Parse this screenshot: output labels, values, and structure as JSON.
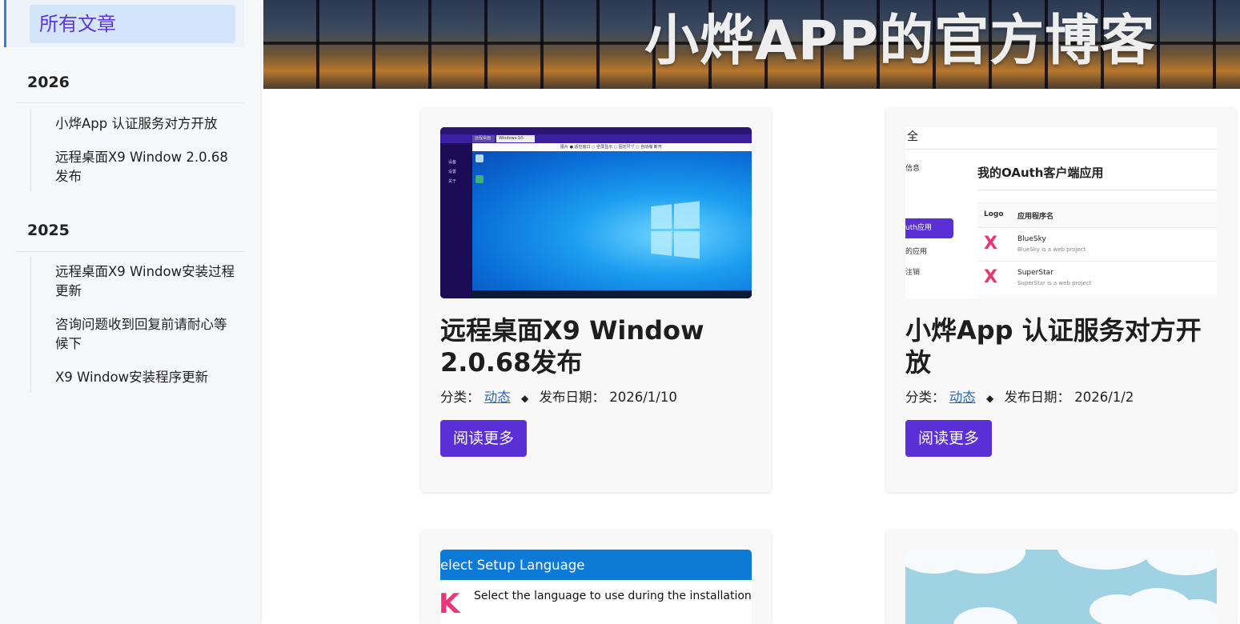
{
  "sidebar": {
    "all_posts": "所有文章",
    "groups": [
      {
        "year": "2026",
        "items": [
          "小烨App 认证服务对方开放",
          "远程桌面X9 Window 2.0.68发布"
        ]
      },
      {
        "year": "2025",
        "items": [
          "远程桌面X9 Window安装过程更新",
          "咨询问题收到回复前请耐心等候下",
          "X9 Window安装程序更新"
        ]
      }
    ]
  },
  "header": {
    "title": "小烨APP的官方博客"
  },
  "posts": [
    {
      "title": "远程桌面X9 Window 2.0.68发布",
      "category_label": "分类：",
      "category": "动态",
      "date_label": "发布日期：",
      "date": "2026/1/10",
      "read_more": "阅读更多",
      "thumb": {
        "tab1": "远程桌面",
        "tab2": "Windows 10-172.16.0.3",
        "toolbar": "图片 ● 适应窗口 ○ 全屏显示 ○ 固定尺寸 ○ 自动缩 断开",
        "side_items": [
          "设备",
          "设置",
          "关于"
        ]
      }
    },
    {
      "title": "小烨App 认证服务对方开放",
      "category_label": "分类：",
      "category": "动态",
      "date_label": "发布日期：",
      "date": "2026/1/2",
      "read_more": "阅读更多",
      "thumb": {
        "head": "全",
        "side_items": [
          "信息",
          "uth应用",
          "的应用",
          "注销"
        ],
        "title": "我的OAuth客户端应用",
        "col_logo": "Logo",
        "col_name": "应用程序名",
        "rows": [
          {
            "name": "BlueSky",
            "desc": "BlueSky is a web project"
          },
          {
            "name": "SuperStar",
            "desc": "SuperStar is a web project"
          }
        ]
      }
    },
    {
      "thumb": {
        "head": "elect Setup Language",
        "body": "Select the language to use during the installation."
      }
    },
    {
      "thumb": {}
    }
  ]
}
